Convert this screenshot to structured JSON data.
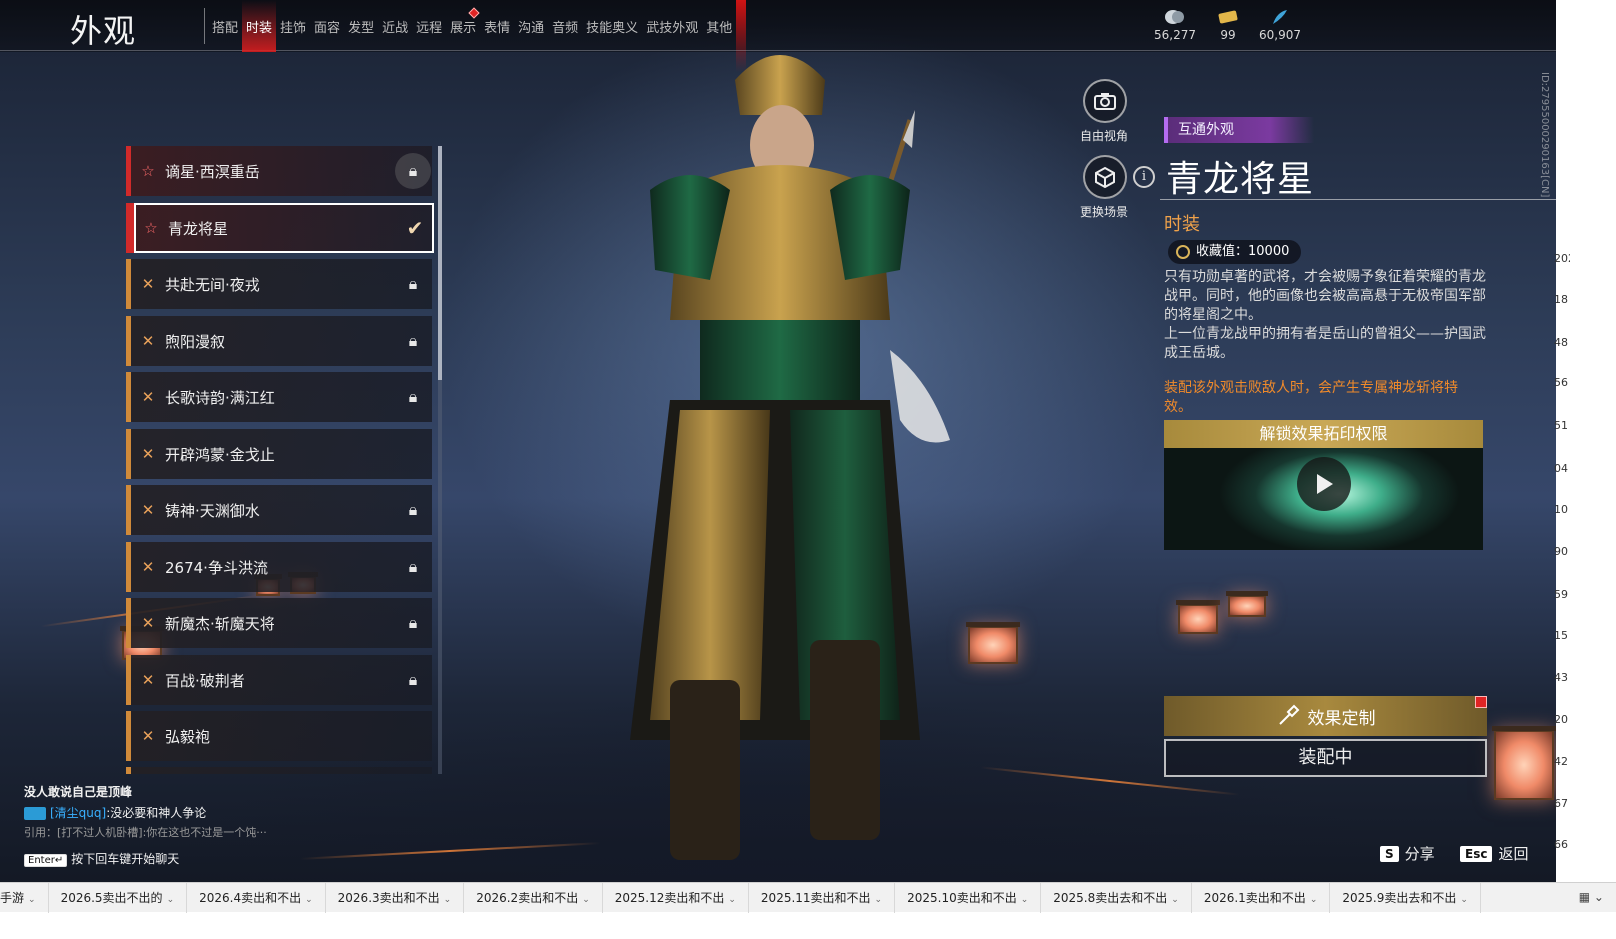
{
  "header": {
    "title": "外观",
    "tabs": [
      {
        "label": "搭配",
        "active": false,
        "dot": false
      },
      {
        "label": "时装",
        "active": true,
        "dot": false
      },
      {
        "label": "挂饰",
        "active": false,
        "dot": false
      },
      {
        "label": "面容",
        "active": false,
        "dot": false
      },
      {
        "label": "发型",
        "active": false,
        "dot": false
      },
      {
        "label": "近战",
        "active": false,
        "dot": false
      },
      {
        "label": "远程",
        "active": false,
        "dot": false
      },
      {
        "label": "展示",
        "active": false,
        "dot": true
      },
      {
        "label": "表情",
        "active": false,
        "dot": false
      },
      {
        "label": "沟通",
        "active": false,
        "dot": false
      },
      {
        "label": "音频",
        "active": false,
        "dot": false
      },
      {
        "label": "技能奥义",
        "active": false,
        "dot": false
      },
      {
        "label": "武技外观",
        "active": false,
        "dot": false
      },
      {
        "label": "其他",
        "active": false,
        "dot": false
      }
    ],
    "currencies": [
      {
        "icon": "jade-coin-icon",
        "value": "56,277"
      },
      {
        "icon": "gold-ticket-icon",
        "value": "99"
      },
      {
        "icon": "feather-token-icon",
        "value": "60,907"
      }
    ]
  },
  "costume_list": [
    {
      "name": "谪星·西溟重岳",
      "rank": "red",
      "locked": true,
      "selected": false
    },
    {
      "name": "青龙将星",
      "rank": "red",
      "locked": false,
      "selected": true
    },
    {
      "name": "共赴无间·夜戎",
      "rank": "gold",
      "locked": true,
      "selected": false
    },
    {
      "name": "煦阳漫叙",
      "rank": "gold",
      "locked": true,
      "selected": false
    },
    {
      "name": "长歌诗韵·满江红",
      "rank": "gold",
      "locked": true,
      "selected": false
    },
    {
      "name": "开辟鸿蒙·金戈止",
      "rank": "gold",
      "locked": false,
      "selected": false
    },
    {
      "name": "铸神·天渊御水",
      "rank": "gold",
      "locked": true,
      "selected": false
    },
    {
      "name": "2674·争斗洪流",
      "rank": "gold",
      "locked": true,
      "selected": false
    },
    {
      "name": "新魔杰·斩魔天将",
      "rank": "gold",
      "locked": true,
      "selected": false
    },
    {
      "name": "百战·破荆者",
      "rank": "gold",
      "locked": true,
      "selected": false
    },
    {
      "name": "弘毅袍",
      "rank": "gold",
      "locked": false,
      "selected": false
    }
  ],
  "side_buttons": {
    "free_view": "自由视角",
    "change_scene": "更换场景"
  },
  "detail": {
    "badge": "互通外观",
    "name": "青龙将星",
    "category": "时装",
    "collect_value": "收藏值：10000",
    "description": [
      "只有功勋卓著的武将，才会被赐予象征着荣耀的青龙战甲。同时，他的画像也会被高高悬于无极帝国军部的将星阁之中。",
      "上一位青龙战甲的拥有者是岳山的曾祖父——护国武成王岳城。"
    ],
    "effect_note": "装配该外观击败敌人时，会产生专属神龙斩将特效。",
    "video_title": "解锁效果拓印权限",
    "custom_button": "效果定制",
    "equip_button": "装配中",
    "id_text": "ID:27955000290163[CN]"
  },
  "chat": {
    "line1": "没人敢说自己是顶峰",
    "nick": "[清尘quq]",
    "line2": ":没必要和神人争论",
    "quote": "引用：[打不过人机卧槽]:你在这也不过是一个饨···",
    "enter_key": "Enter↵",
    "hint": "按下回车键开始聊天"
  },
  "hotkeys": [
    {
      "key": "S",
      "label": "分享"
    },
    {
      "key": "Esc",
      "label": "返回"
    }
  ],
  "sheet_tabs": [
    "手游",
    "2026.5卖出不出的",
    "2026.4卖出和不出",
    "2026.3卖出和不出",
    "2026.2卖出和不出",
    "2025.12卖出和不出",
    "2025.11卖出和不出",
    "2025.10卖出和不出",
    "2025.8卖出去和不出",
    "2026.1卖出和不出",
    "2025.9卖出去和不出"
  ],
  "right_numbers": [
    "202",
    "18",
    "48",
    "56",
    "51",
    "04",
    "10",
    "90",
    "59",
    "15",
    "43",
    "20",
    "42",
    "67",
    "66"
  ],
  "colors": {
    "accent_red": "#d12a2a",
    "rank_gold": "#d08a3a",
    "category_orange": "#f0a24a",
    "badge_purple": "#7b3aa0"
  }
}
